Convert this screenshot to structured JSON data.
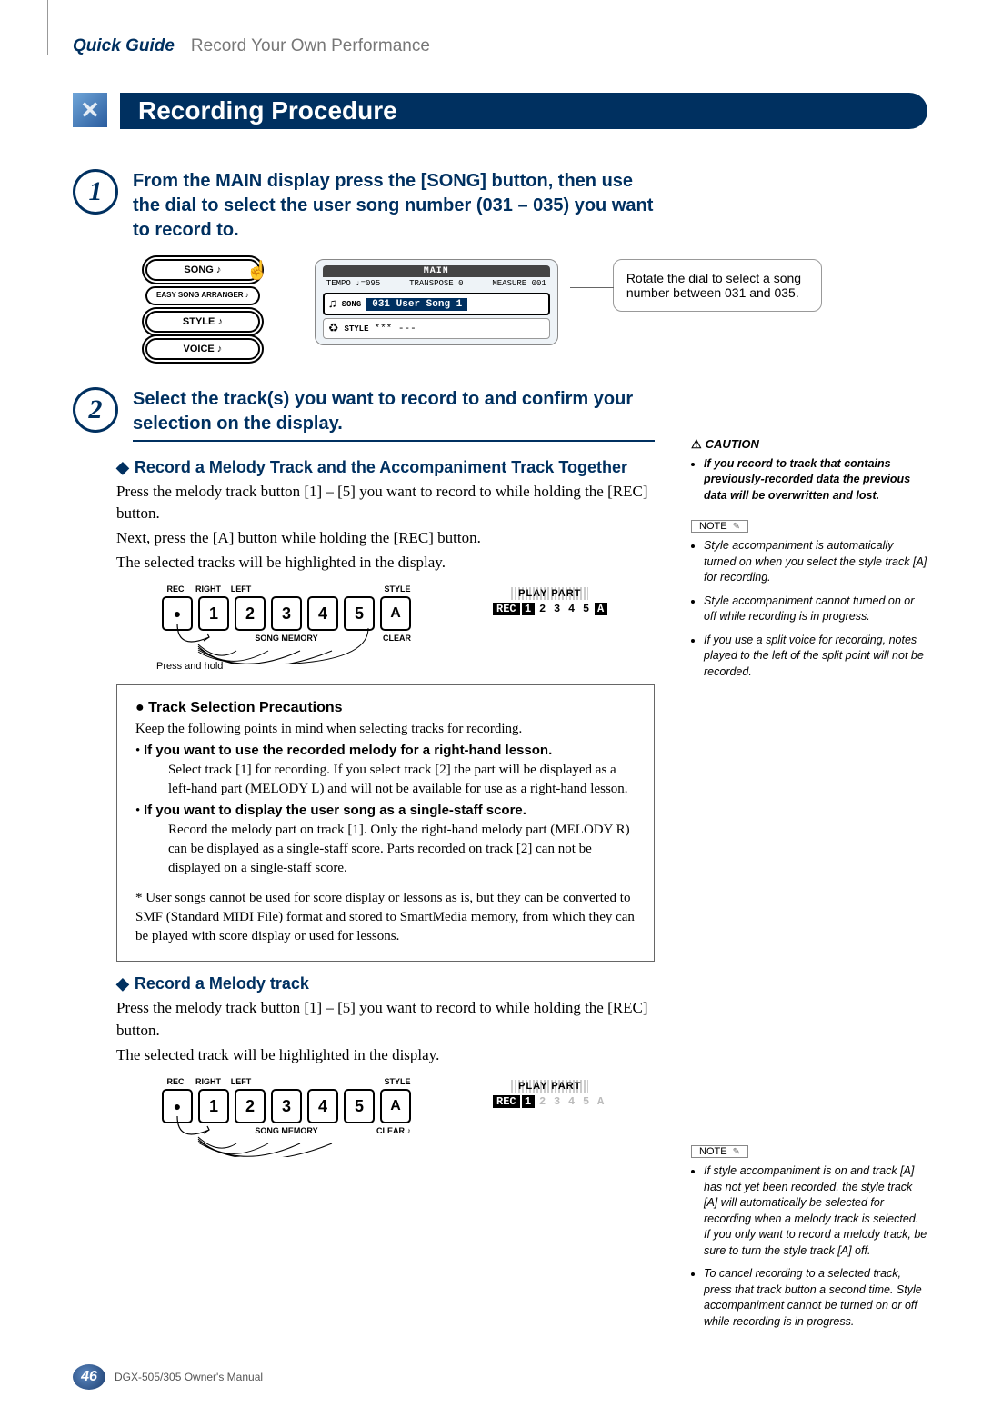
{
  "header": {
    "quick_guide": "Quick Guide",
    "breadcrumb": "Record Your Own Performance"
  },
  "section_title": "Recording Procedure",
  "step1": {
    "num": "1",
    "text": "From the MAIN display press the [SONG] button, then use the dial to select the user song number (031 – 035) you want to record to.",
    "buttons": {
      "song": "SONG",
      "easy": "EASY SONG\nARRANGER",
      "style": "STYLE",
      "voice": "VOICE"
    },
    "lcd": {
      "title": "MAIN",
      "tempo": "TEMPO ♩=095",
      "transpose": "TRANSPOSE 0",
      "measure": "MEASURE 001",
      "song_label": "SONG",
      "song_value": "031 User Song 1",
      "style_label": "STYLE",
      "style_value": "*** ---"
    },
    "callout": "Rotate the dial to select a song number between 031 and 035."
  },
  "step2": {
    "num": "2",
    "text": "Select the track(s) you want to record to and confirm your selection on the display.",
    "subA": {
      "title": "Record a Melody Track and the Accompaniment Track Together",
      "p1": "Press the melody track button [1] – [5] you want to record to while holding the [REC] button.",
      "p2": "Next, press the [A] button while holding the [REC] button.",
      "p3": "The selected tracks will be highlighted in the display."
    },
    "kb": {
      "labels": {
        "rec": "REC",
        "right": "RIGHT",
        "left": "LEFT",
        "style": "STYLE"
      },
      "buttons": [
        "1",
        "2",
        "3",
        "4",
        "5",
        "A"
      ],
      "under": "SONG MEMORY",
      "clear": "CLEAR",
      "press_hold": "Press and hold"
    },
    "play_part_a": {
      "title": "PLAY PART",
      "rec": "REC",
      "cells": [
        "1",
        "2",
        "3",
        "4",
        "5",
        "A"
      ]
    },
    "precautions": {
      "title": "Track Selection Precautions",
      "intro": "Keep the following points in mind when selecting tracks for recording.",
      "b1_lead": "If you want to use the recorded melody for a right-hand lesson.",
      "b1_body": "Select track [1] for recording. If you select track [2] the part will be displayed as a left-hand part (MELODY L) and will not be available for use as a right-hand lesson.",
      "b2_lead": "If you want to display the user song as a single-staff score.",
      "b2_body": "Record the melody part on track [1]. Only the right-hand melody part (MELODY R) can be displayed as a single-staff score. Parts recorded on track [2] can not be displayed on a single-staff score.",
      "asterisk": "* User songs cannot be used for score display or lessons as is, but they can be converted to SMF (Standard MIDI File) format and stored to SmartMedia memory, from which they can be played with score display or used for lessons."
    },
    "subB": {
      "title": "Record a Melody track",
      "p1": "Press the melody track button [1] – [5] you want to record to while holding the [REC] button.",
      "p2": "The selected track will be highlighted in the display."
    },
    "play_part_b": {
      "title": "PLAY PART",
      "rec": "REC",
      "cells": [
        "1",
        "2",
        "3",
        "4",
        "5",
        "A"
      ]
    }
  },
  "side": {
    "caution_label": "CAUTION",
    "caution_item": "If you record to track that contains previously-recorded data the previous data will be overwritten and lost.",
    "note_label": "NOTE",
    "note1_items": [
      "Style accompaniment is automatically turned on when you select the style track [A] for recording.",
      "Style accompaniment cannot turned on or off while recording is in progress.",
      "If you use a split voice for recording, notes played to the left of the split point will not be recorded."
    ],
    "note2_items": [
      "If style accompaniment is on and track [A] has not yet been recorded, the style track [A] will automatically be selected for recording when a melody track is selected. If you only want to record a melody track, be sure to turn the style track [A] off.",
      "To cancel recording to a selected track, press that track button a second time. Style accompaniment cannot be turned on or off while recording is in progress."
    ]
  },
  "footer": {
    "page": "46",
    "text": "DGX-505/305  Owner's Manual"
  }
}
